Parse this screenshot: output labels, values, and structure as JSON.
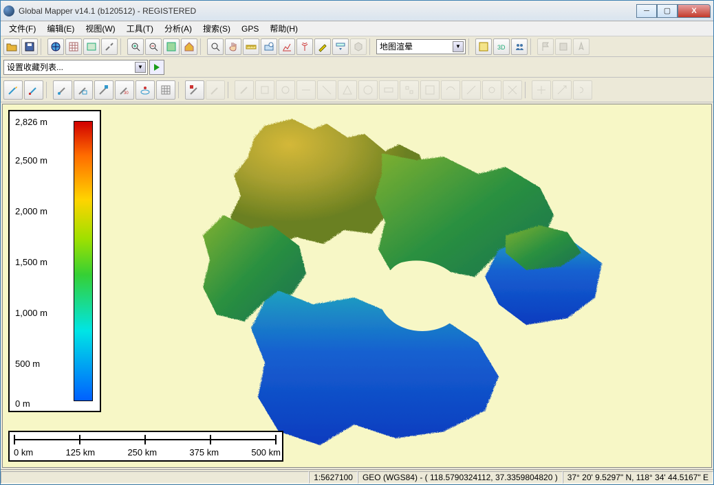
{
  "title": "Global Mapper v14.1 (b120512) - REGISTERED",
  "menu": [
    "文件(F)",
    "编辑(E)",
    "视图(W)",
    "工具(T)",
    "分析(A)",
    "搜索(S)",
    "GPS",
    "帮助(H)"
  ],
  "comboFavorites": "设置收藏列表...",
  "comboShader": "地图渲晕",
  "legend": {
    "max": "2,826 m",
    "t1": "2,500 m",
    "t2": "2,000 m",
    "t3": "1,500 m",
    "t4": "1,000 m",
    "t5": "500 m",
    "min": "0 m"
  },
  "scale": {
    "s0": "0 km",
    "s1": "125 km",
    "s2": "250 km",
    "s3": "375 km",
    "s4": "500 km"
  },
  "status": {
    "scale": "1:5627100",
    "proj": "GEO (WGS84) - ( 118.5790324112, 37.3359804820 )",
    "coord": "37° 20' 9.5297\" N, 118° 34' 44.5167\" E"
  }
}
